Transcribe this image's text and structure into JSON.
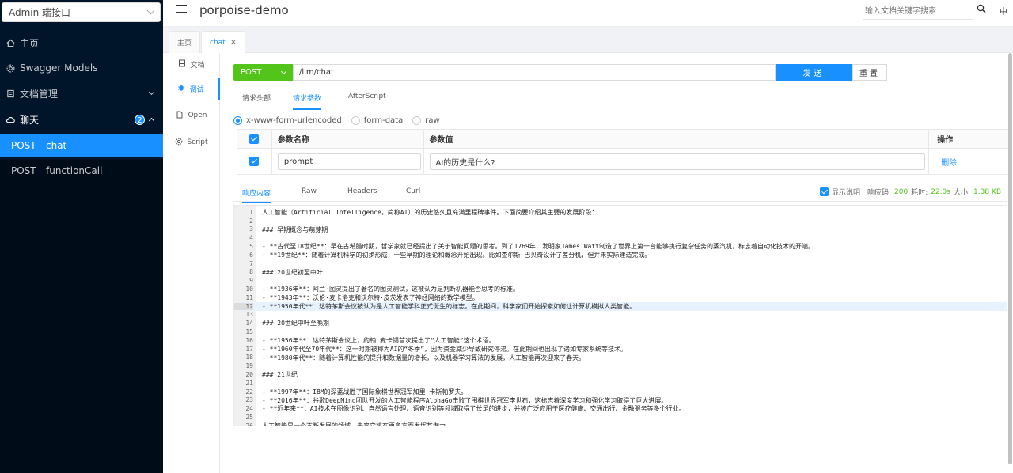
{
  "sidebar": {
    "group_select": "Admin 端接口",
    "items": [
      {
        "label": "主页",
        "icon": "home-icon"
      },
      {
        "label": "Swagger Models",
        "icon": "models-icon"
      },
      {
        "label": "文档管理",
        "icon": "doc-manage-icon"
      },
      {
        "label": "聊天",
        "icon": "cloud-icon",
        "badge": "2"
      }
    ],
    "sub_items": [
      {
        "method": "POST",
        "name": "chat"
      },
      {
        "method": "POST",
        "name": "functionCall"
      }
    ]
  },
  "header": {
    "title": "porpoise-demo",
    "search_placeholder": "输入文档关键字搜索",
    "lang": "中"
  },
  "page_tabs": [
    {
      "label": "主页"
    },
    {
      "label": "chat",
      "close": "×"
    }
  ],
  "vnav": [
    {
      "label": "文档"
    },
    {
      "label": "调试"
    },
    {
      "label": "Open"
    },
    {
      "label": "Script"
    }
  ],
  "request": {
    "method": "POST",
    "url": "/llm/chat",
    "send_label": "发送",
    "reset_label": "重置",
    "tabs": [
      "请求头部",
      "请求参数",
      "AfterScript"
    ],
    "body_types": [
      "x-www-form-urlencoded",
      "form-data",
      "raw"
    ],
    "params_headers": {
      "name": "参数名称",
      "value": "参数值",
      "action": "操作"
    },
    "params": [
      {
        "name": "prompt",
        "value": "AI的历史是什么?",
        "action": "删除"
      }
    ]
  },
  "response": {
    "tabs": [
      "响应内容",
      "Raw",
      "Headers",
      "Curl"
    ],
    "show_desc_label": "显示说明",
    "status_label": "响应码:",
    "status_code": "200",
    "time_label": "耗时:",
    "time_value": "22.0s",
    "size_label": "大小:",
    "size_value": "1.38 KB",
    "highlighted_line": 12,
    "lines": [
      "人工智能（Artificial Intelligence，简称AI）的历史悠久且充满里程碑事件。下面简要介绍其主要的发展阶段：",
      "",
      "### 早期概念与萌芽期",
      "",
      "- **古代至18世纪**：早在古希腊时期，哲学家就已经提出了关于智能问题的思考。到了1769年，发明家James Watt制造了世界上第一台能够执行复杂任务的蒸汽机，标志着自动化技术的开端。",
      "- **19世纪**：随着计算机科学的初步形成，一些早期的理论和概念开始出现。比如查尔斯·巴贝奇设计了差分机，但并未实际建造完成。",
      "",
      "### 20世纪初至中叶",
      "",
      "- **1936年**：阿兰·图灵提出了著名的图灵测试，这被认为是判断机器能否思考的标准。",
      "- **1943年**：沃伦·麦卡洛克和沃尔特·皮茨发表了神经网络的数学模型。",
      "- **1950年代**：达特茅斯会议被认为是人工智能学科正式诞生的标志。在此期间，科学家们开始探索如何让计算机模拟人类智能。",
      "",
      "### 20世纪中叶至晚期",
      "",
      "- **1956年**：达特茅斯会议上，约翰·麦卡锡首次提出了“人工智能”这个术语。",
      "- **1960年代至70年代**：这一时期被称为AI的“冬季”，因为资金减少导致研究停滞。在此期间也出现了诸如专家系统等技术。",
      "- **1980年代**：随着计算机性能的提升和数据量的增长，以及机器学习算法的发展，人工智能再次迎来了春天。",
      "",
      "### 21世纪",
      "",
      "- **1997年**：IBM的深蓝战胜了国际象棋世界冠军加里·卡斯帕罗夫。",
      "- **2016年**：谷歌DeepMind团队开发的人工智能程序AlphaGo击败了围棋世界冠军李世石，这标志着深度学习和强化学习取得了巨大进展。",
      "- **近年来**：AI技术在图像识别、自然语言处理、语音识别等领域取得了长足的进步，并被广泛应用于医疗健康、交通出行、金融服务等多个行业。",
      "",
      "人工智能是一个不断发展的领域，未来它将在更多方面发挥其潜力。"
    ]
  },
  "colors": {
    "sidebar_bg": "#001529",
    "accent": "#1890ff",
    "method_green": "#52c41a"
  }
}
